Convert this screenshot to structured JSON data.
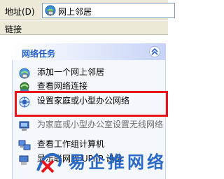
{
  "address_bar": {
    "label": "地址(D)",
    "value": "网上邻居",
    "icon": "network-places-icon"
  },
  "links_bar": {
    "label": "链接"
  },
  "task_pane": {
    "title": "网络任务",
    "collapse_icon": "chevron-up-icon",
    "tasks": [
      {
        "label": "添加一个网上邻居",
        "icon": "add-network-place-icon"
      },
      {
        "label": "查看网络连接",
        "icon": "network-connections-icon"
      },
      {
        "label": "设置家庭或小型办公网络",
        "icon": "setup-network-icon"
      },
      {
        "label": "为家庭或小型办公室设置无线网络",
        "icon": "wireless-network-icon"
      },
      {
        "label": "查看工作组计算机",
        "icon": "workgroup-computers-icon"
      },
      {
        "label": "显示联网的 UPnP 设备",
        "icon": "upnp-devices-icon"
      }
    ]
  },
  "watermark": {
    "text": "易企推网络"
  },
  "colors": {
    "highlight": "#e8141c",
    "panel_title": "#215dc6",
    "watermark": "#2a6ac6"
  }
}
